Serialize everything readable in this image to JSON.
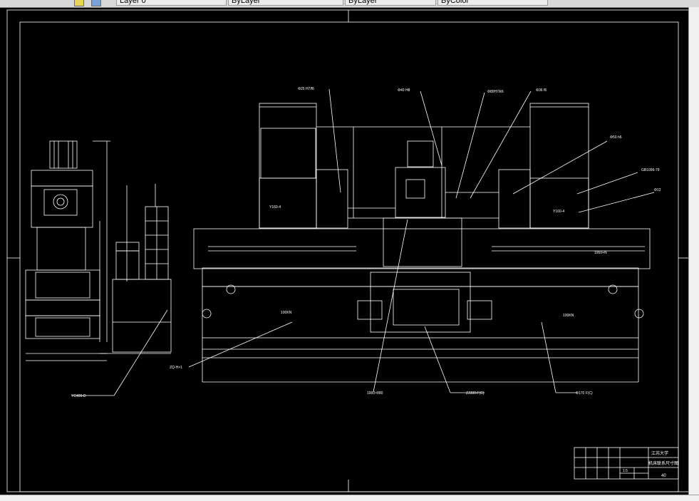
{
  "toolbar": {
    "tabs": [
      {
        "label": "Layer 0"
      },
      {
        "label": "ByLayer"
      },
      {
        "label": "ByLayer"
      },
      {
        "label": "ByColor"
      }
    ],
    "icon_names": [
      "pencil-icon",
      "layer-icon"
    ]
  },
  "drawing": {
    "title_block": {
      "school": "江苏大学",
      "drawing_name": "机床联系尺寸图",
      "scale": "1:5",
      "sheet_no": "40"
    },
    "callouts": {
      "left_leader": "ZQ-H×1",
      "left_bottom": "YC400-D",
      "center_bottom": "1000×880",
      "middle_bottom": "ZJ300-F(C)",
      "right_bottom": "Φ170 F(C)",
      "top_left": "Φ25 H7/f6",
      "top_mid": "Φ40 H8",
      "top_mid2": "Φ80H7/k6",
      "top_right": "Φ36 f6",
      "right_top": "Φ50 h6",
      "right_mid": "GB1096-79",
      "right_small": "Φ12",
      "rail_label": "1950+N",
      "bed_left": "100KN",
      "bed_right": "100KN",
      "motor_left": "Y160-4",
      "motor_right": "Y160-4"
    },
    "accent_colors": {
      "background": "#000000",
      "lines": "#ffffff"
    }
  }
}
